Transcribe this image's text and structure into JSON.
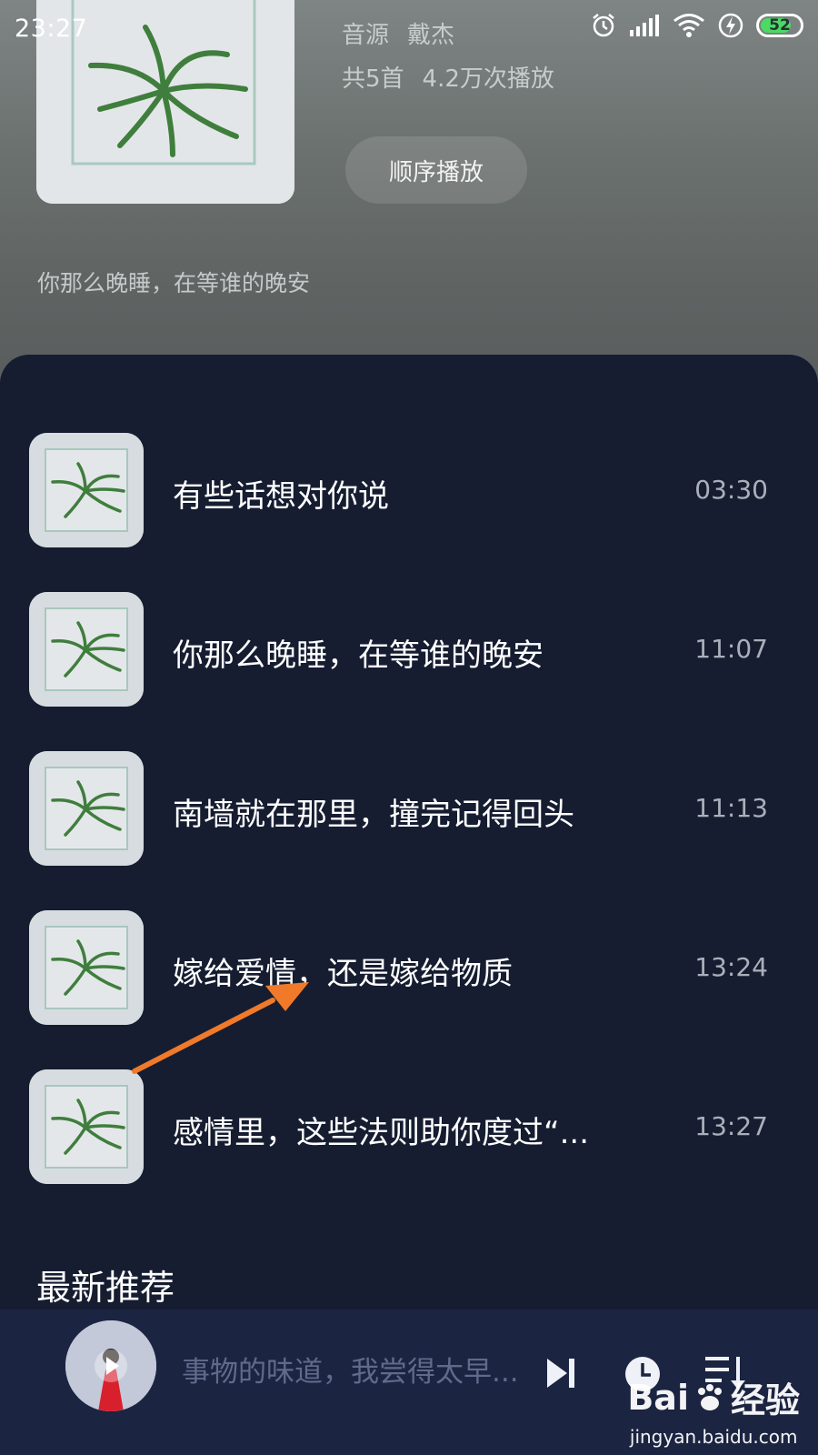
{
  "status": {
    "time": "23:27",
    "battery": "52"
  },
  "album": {
    "source_label": "音源",
    "source_name": "戴杰",
    "count": "共5首",
    "plays": "4.2万次播放",
    "play_order_label": "顺序播放",
    "subtitle": "你那么晚睡，在等谁的晚安"
  },
  "tracks": [
    {
      "title": "有些话想对你说",
      "duration": "03:30"
    },
    {
      "title": "你那么晚睡，在等谁的晚安",
      "duration": "11:07"
    },
    {
      "title": "南墙就在那里，撞完记得回头",
      "duration": "11:13"
    },
    {
      "title": "嫁给爱情，还是嫁给物质",
      "duration": "13:24"
    },
    {
      "title": "感情里，这些法则助你度过“...",
      "duration": "13:27"
    }
  ],
  "section": {
    "title": "最新推荐"
  },
  "player": {
    "now_playing": "事物的味道，我尝得太早..."
  },
  "watermark": {
    "brand": "Bai",
    "brand2": "经验",
    "url": "jingyan.baidu.com"
  },
  "colors": {
    "annotation_arrow": "#f07a2a",
    "battery_green": "#4cd964"
  }
}
